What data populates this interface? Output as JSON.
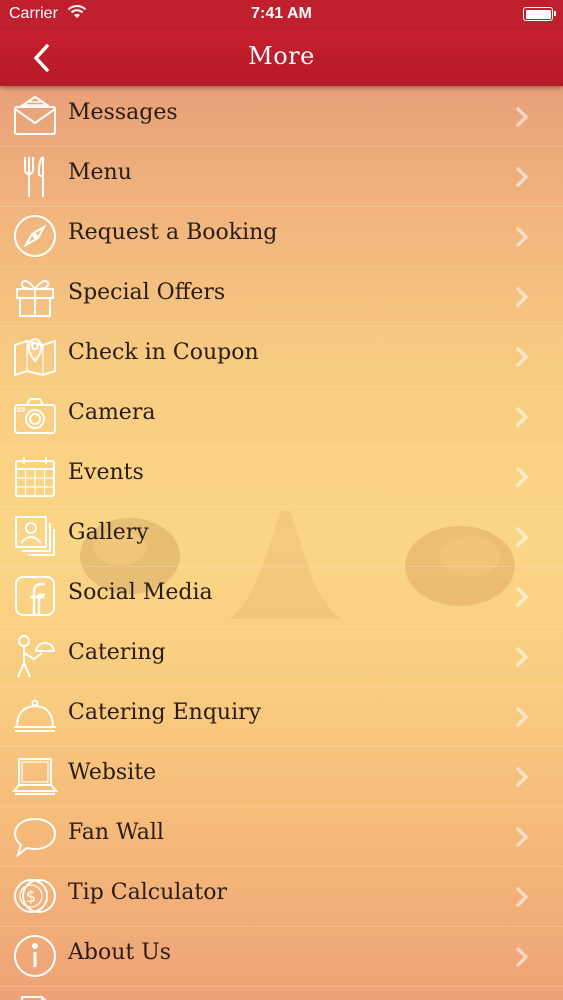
{
  "status_bar": {
    "carrier": "Carrier",
    "time": "7:41 AM"
  },
  "nav": {
    "title": "More",
    "back_icon": "chevron-left-icon"
  },
  "menu_items": [
    {
      "label": "Messages",
      "icon": "envelope-icon"
    },
    {
      "label": "Menu",
      "icon": "fork-knife-icon"
    },
    {
      "label": "Request a Booking",
      "icon": "compass-icon"
    },
    {
      "label": "Special Offers",
      "icon": "gift-icon"
    },
    {
      "label": "Check in Coupon",
      "icon": "map-pin-icon"
    },
    {
      "label": "Camera",
      "icon": "camera-icon"
    },
    {
      "label": "Events",
      "icon": "calendar-icon"
    },
    {
      "label": "Gallery",
      "icon": "photos-icon"
    },
    {
      "label": "Social Media",
      "icon": "facebook-icon"
    },
    {
      "label": "Catering",
      "icon": "waiter-icon"
    },
    {
      "label": "Catering Enquiry",
      "icon": "cloche-icon"
    },
    {
      "label": "Website",
      "icon": "laptop-icon"
    },
    {
      "label": "Fan Wall",
      "icon": "speech-bubble-icon"
    },
    {
      "label": "Tip Calculator",
      "icon": "coins-icon"
    },
    {
      "label": "About Us",
      "icon": "info-icon"
    },
    {
      "label": "",
      "icon": "document-icon"
    }
  ]
}
